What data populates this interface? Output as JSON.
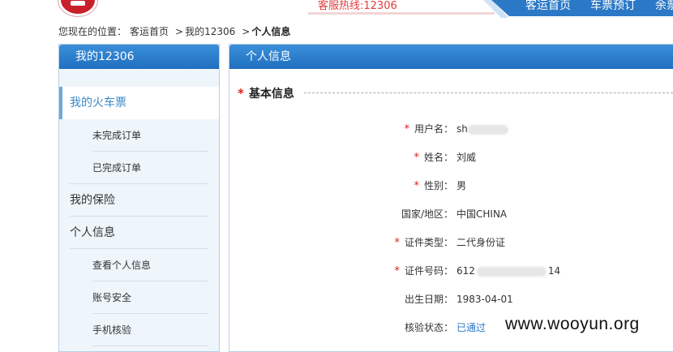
{
  "header": {
    "hotline": "客服热线:12306",
    "nav": [
      "客运首页",
      "车票预订",
      "余票"
    ]
  },
  "breadcrumb": {
    "prefix": "您现在的位置：",
    "items": [
      "客运首页",
      "我的12306",
      "个人信息"
    ],
    "separator": ">"
  },
  "sidebar": {
    "title": "我的12306",
    "items": [
      {
        "label": "我的火车票",
        "level": 1,
        "active": true
      },
      {
        "label": "未完成订单",
        "level": 2
      },
      {
        "label": "已完成订单",
        "level": 2
      },
      {
        "label": "我的保险",
        "level": 1
      },
      {
        "label": "个人信息",
        "level": 1
      },
      {
        "label": "查看个人信息",
        "level": 2
      },
      {
        "label": "账号安全",
        "level": 2
      },
      {
        "label": "手机核验",
        "level": 2
      }
    ]
  },
  "main": {
    "title": "个人信息",
    "section": "基本信息",
    "fields": {
      "username": {
        "label": "用户名：",
        "value": "sh",
        "required": true
      },
      "name": {
        "label": "姓名：",
        "value": "刘威",
        "required": true
      },
      "gender": {
        "label": "性别：",
        "value": "男",
        "required": true
      },
      "country": {
        "label": "国家/地区：",
        "value": "中国CHINA",
        "required": false
      },
      "id_type": {
        "label": "证件类型：",
        "value": "二代身份证",
        "required": true
      },
      "id_number": {
        "label": "证件号码：",
        "value_start": "612",
        "value_end": "14",
        "required": true
      },
      "birth": {
        "label": "出生日期：",
        "value": "1983-04-01",
        "required": false
      },
      "verify": {
        "label": "核验状态：",
        "value": "已通过",
        "required": false
      }
    },
    "required_mark": "*"
  },
  "watermark": "www.wooyun.org",
  "colors": {
    "accent_blue": "#2b78c6",
    "required_red": "#d8231d",
    "hotline_red": "#e23c3c",
    "link_blue": "#2a78c8",
    "sidebar_bg": "#eef5fb"
  }
}
